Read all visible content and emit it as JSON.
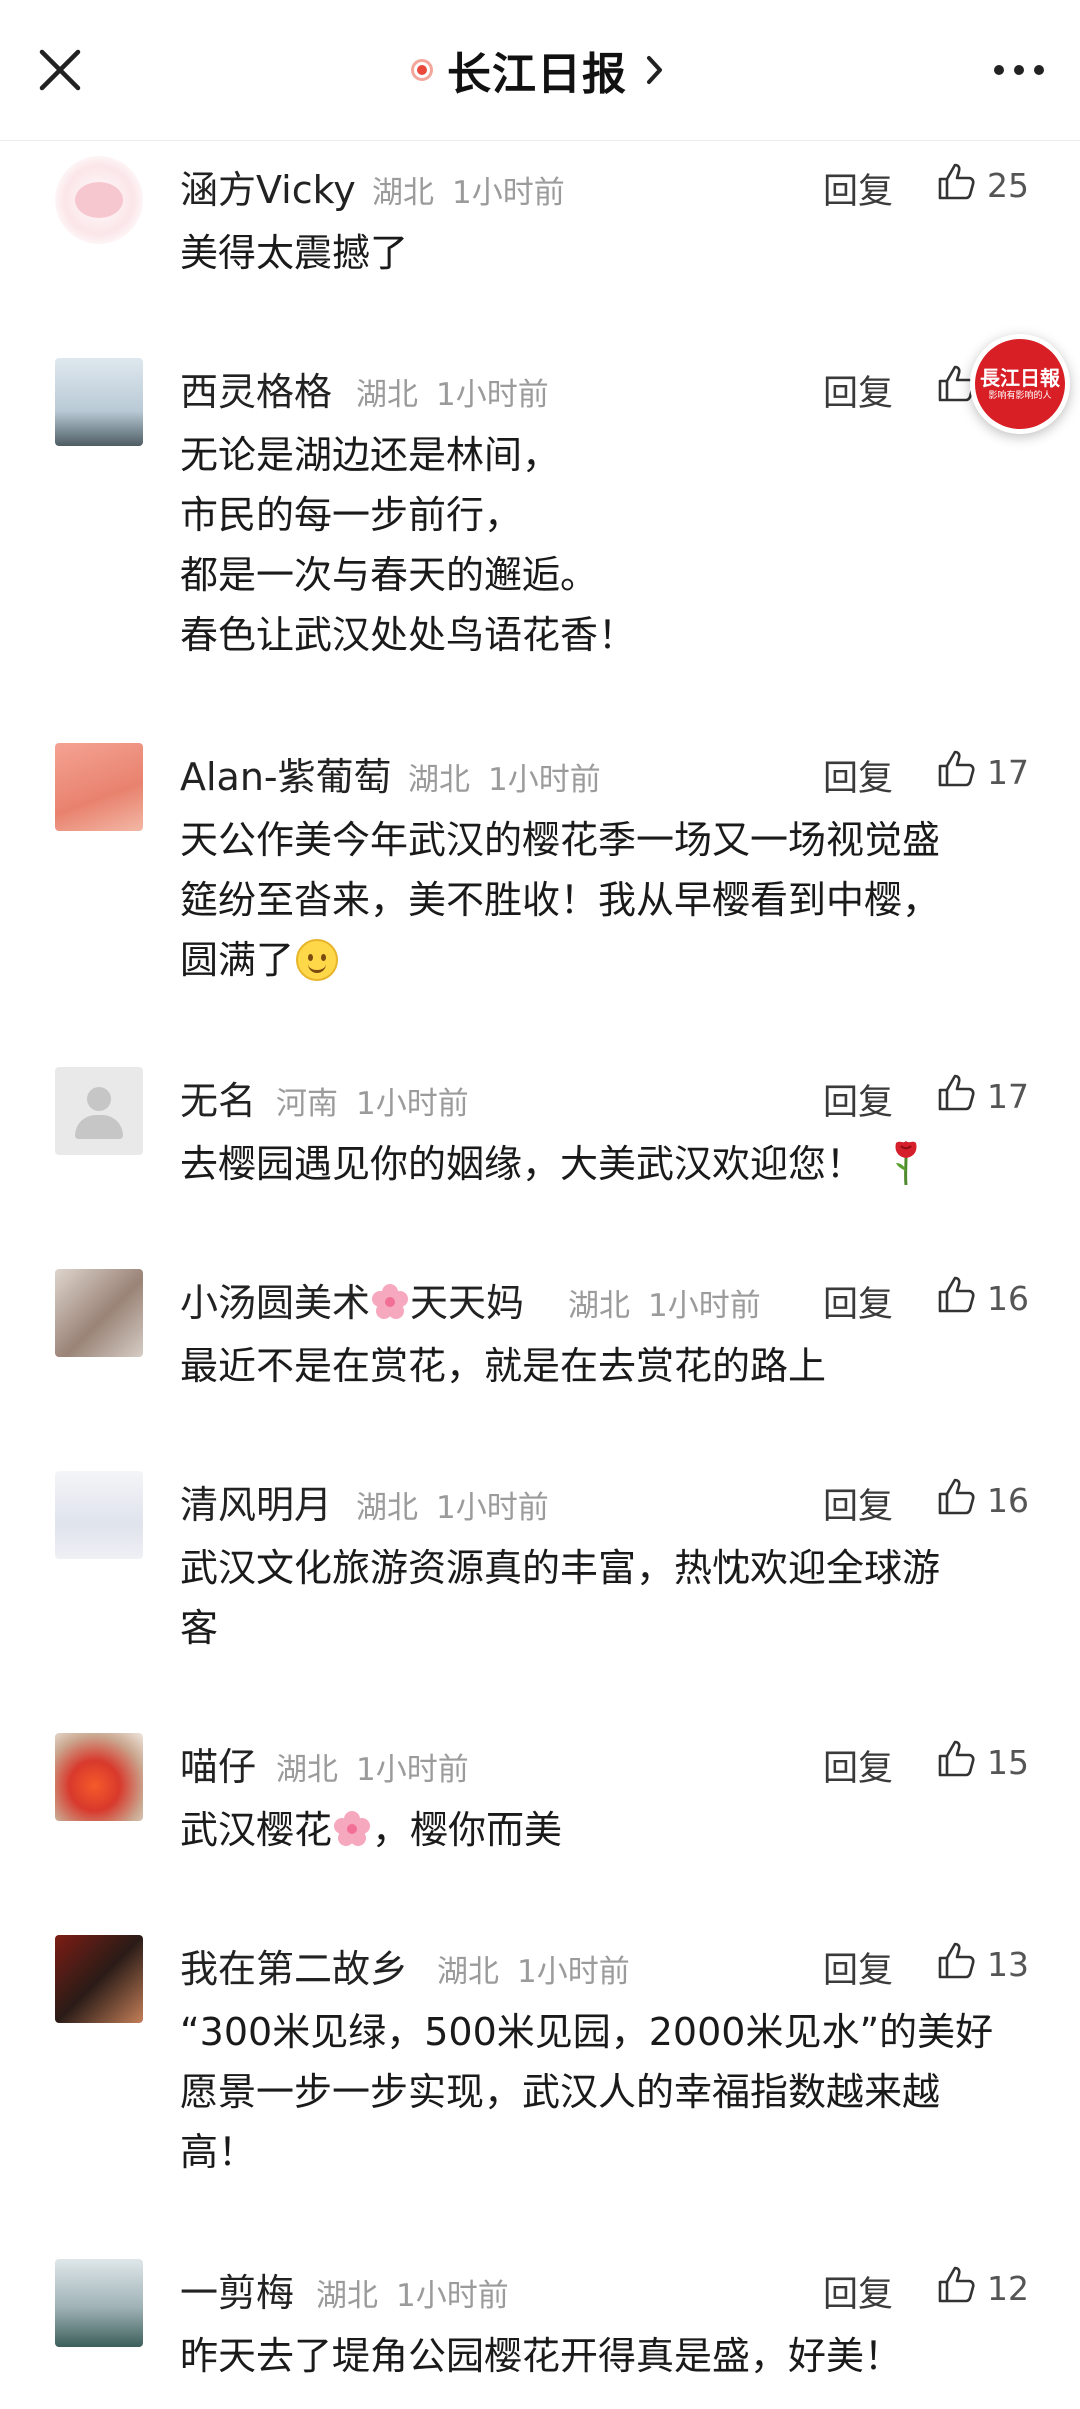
{
  "header": {
    "title": "长江日报",
    "close_icon": "close-icon",
    "more_icon": "more-icon"
  },
  "floating_logo": {
    "text": "長江日報",
    "sub": "影响有影响的人"
  },
  "reply_label": "回复",
  "comments": [
    {
      "name": "涵方Vicky",
      "region": "湖北",
      "time": "1小时前",
      "likes": "25",
      "text": "美得太震撼了"
    },
    {
      "name": "西灵格格",
      "region": "湖北",
      "time": "1小时前",
      "likes": "",
      "text": "无论是湖边还是林间，\n市民的每一步前行，\n都是一次与春天的邂逅。\n春色让武汉处处鸟语花香！"
    },
    {
      "name": "Alan-紫葡萄",
      "region": "湖北",
      "time": "1小时前",
      "likes": "17",
      "text": "天公作美今年武汉的樱花季一场又一场视觉盛\n筵纷至沓来，美不胜收！我从早樱看到中樱，\n圆满了"
    },
    {
      "name": "无名",
      "region": "河南",
      "time": "1小时前",
      "likes": "17",
      "text": "去樱园遇见你的姻缘，大美武汉欢迎您！"
    },
    {
      "name_part1": "小汤圆美术",
      "name_part2": "天天妈",
      "region": "湖北",
      "time": "1小时前",
      "likes": "16",
      "text": "最近不是在赏花，就是在去赏花的路上"
    },
    {
      "name": "清风明月",
      "region": "湖北",
      "time": "1小时前",
      "likes": "16",
      "text": "武汉文化旅游资源真的丰富，热忱欢迎全球游\n客"
    },
    {
      "name": "喵仔",
      "region": "湖北",
      "time": "1小时前",
      "likes": "15",
      "text_part1": "武汉樱花",
      "text_part2": "，樱你而美"
    },
    {
      "name": "我在第二故乡",
      "region": "湖北",
      "time": "1小时前",
      "likes": "13",
      "text": "“300米见绿，500米见园，2000米见水”的美好\n愿景一步一步实现，武汉人的幸福指数越来越\n高！"
    },
    {
      "name": "一剪梅",
      "region": "湖北",
      "time": "1小时前",
      "likes": "12",
      "text": "昨天去了堤角公园樱花开得真是盛，好美！"
    }
  ]
}
